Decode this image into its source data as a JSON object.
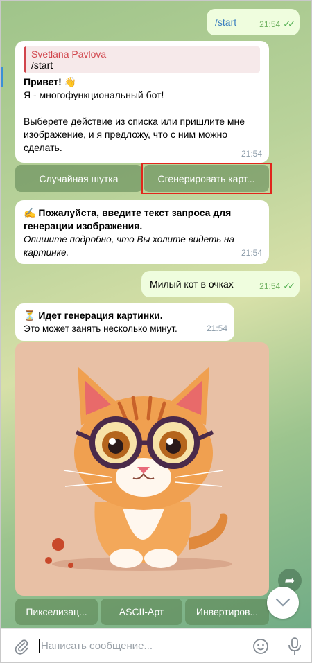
{
  "colors": {
    "accent": "#3a8fd6",
    "outgoing_bubble": "#effdde",
    "highlight": "#e1261c",
    "reply_bar": "#d1454c"
  },
  "messages": {
    "start": {
      "text": "/start",
      "time": "21:54"
    },
    "welcome": {
      "reply_name": "Svetlana Pavlova",
      "reply_text": "/start",
      "line1": "Привет! 👋",
      "line2": "Я - многофункциональный бот!",
      "line3": "Выберете действие из списка или пришлите мне изображение, и я предложу, что с ним можно сделать.",
      "time": "21:54"
    },
    "prompt": {
      "title": "✍ Пожалуйста, введите текст запроса для генерации изображения.",
      "subtitle": "Опишите подробно, что Вы холите видеть на картинке.",
      "time": "21:54"
    },
    "cat_request": {
      "text": "Милый кот в очках",
      "time": "21:54"
    },
    "generating": {
      "title": "⏳ Идет генерация картинки.",
      "subtitle": "Это может занять несколько минут.",
      "time": "21:54"
    }
  },
  "keyboard1": {
    "joke": "Случайная шутка",
    "generate": "Сгенерировать карт..."
  },
  "keyboard2": {
    "pixelize": "Пикселизац...",
    "ascii": "ASCII-Арт",
    "invert": "Инвертиров..."
  },
  "input": {
    "placeholder": "Написать сообщение..."
  },
  "icons": {
    "attach": "paperclip-icon",
    "emoji": "emoji-icon",
    "mic": "microphone-icon",
    "share": "share-icon",
    "scroll_down": "chevron-down-icon",
    "read": "double-check-icon"
  }
}
